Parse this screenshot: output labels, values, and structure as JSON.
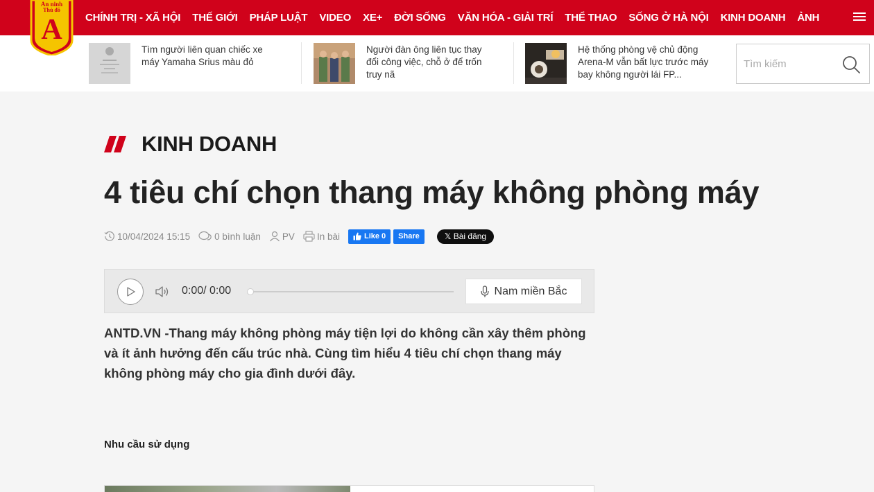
{
  "nav": {
    "items": [
      "CHÍNH TRỊ - XÃ HỘI",
      "THẾ GIỚI",
      "PHÁP LUẬT",
      "VIDEO",
      "XE+",
      "ĐỜI SỐNG",
      "VĂN HÓA - GIẢI TRÍ",
      "THỂ THAO",
      "SỐNG Ở HÀ NỘI",
      "KINH DOANH",
      "ẢNH"
    ]
  },
  "logo": {
    "line1": "An ninh",
    "line2": "Thủ đô",
    "letter": "A"
  },
  "news": [
    {
      "title": "Tìm người liên quan chiếc xe máy Yamaha Srius màu đỏ"
    },
    {
      "title": "Người đàn ông liên tục thay đổi công việc, chỗ ở để trốn truy nã"
    },
    {
      "title": "Hệ thống phòng vệ chủ động Arena-M vẫn bất lực trước máy bay không người lái FP..."
    }
  ],
  "search": {
    "placeholder": "Tìm kiếm"
  },
  "category": "KINH DOANH",
  "article": {
    "title": "4 tiêu chí chọn thang máy không phòng máy",
    "datetime": "10/04/2024 15:15",
    "comments": "0 bình luận",
    "author": "PV",
    "print": "In bài",
    "fb_like": "Like 0",
    "fb_share": "Share",
    "x_post": "𝕏 Bài đăng",
    "sapo": "ANTD.VN -Thang máy không phòng máy tiện lợi do không cần xây thêm phòng và ít ảnh hưởng đến cấu trúc nhà. Cùng tìm hiểu 4 tiêu chí chọn thang máy không phòng máy cho gia đình dưới đây.",
    "subheading": "Nhu cầu sử dụng"
  },
  "audio": {
    "time": "0:00/ 0:00",
    "progress": 0,
    "voice": "Nam miền Bắc"
  },
  "colors": {
    "brand": "#d0021b",
    "logo_yellow": "#f5c400",
    "facebook": "#1877f2"
  }
}
